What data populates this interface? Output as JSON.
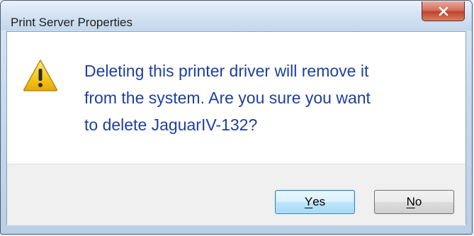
{
  "window": {
    "title": "Print Server Properties",
    "close_label": "x"
  },
  "dialog": {
    "icon": "warning-icon",
    "message": "Deleting this printer driver will remove it\nfrom the system.  Are you sure you want\nto delete JaguarIV-132?"
  },
  "buttons": {
    "yes": {
      "mnemonic": "Y",
      "rest": "es"
    },
    "no": {
      "mnemonic": "N",
      "rest": "o"
    }
  },
  "colors": {
    "message_text": "#1e3fa0",
    "close_button": "#c0432e",
    "warning_fill": "#f5c518"
  }
}
